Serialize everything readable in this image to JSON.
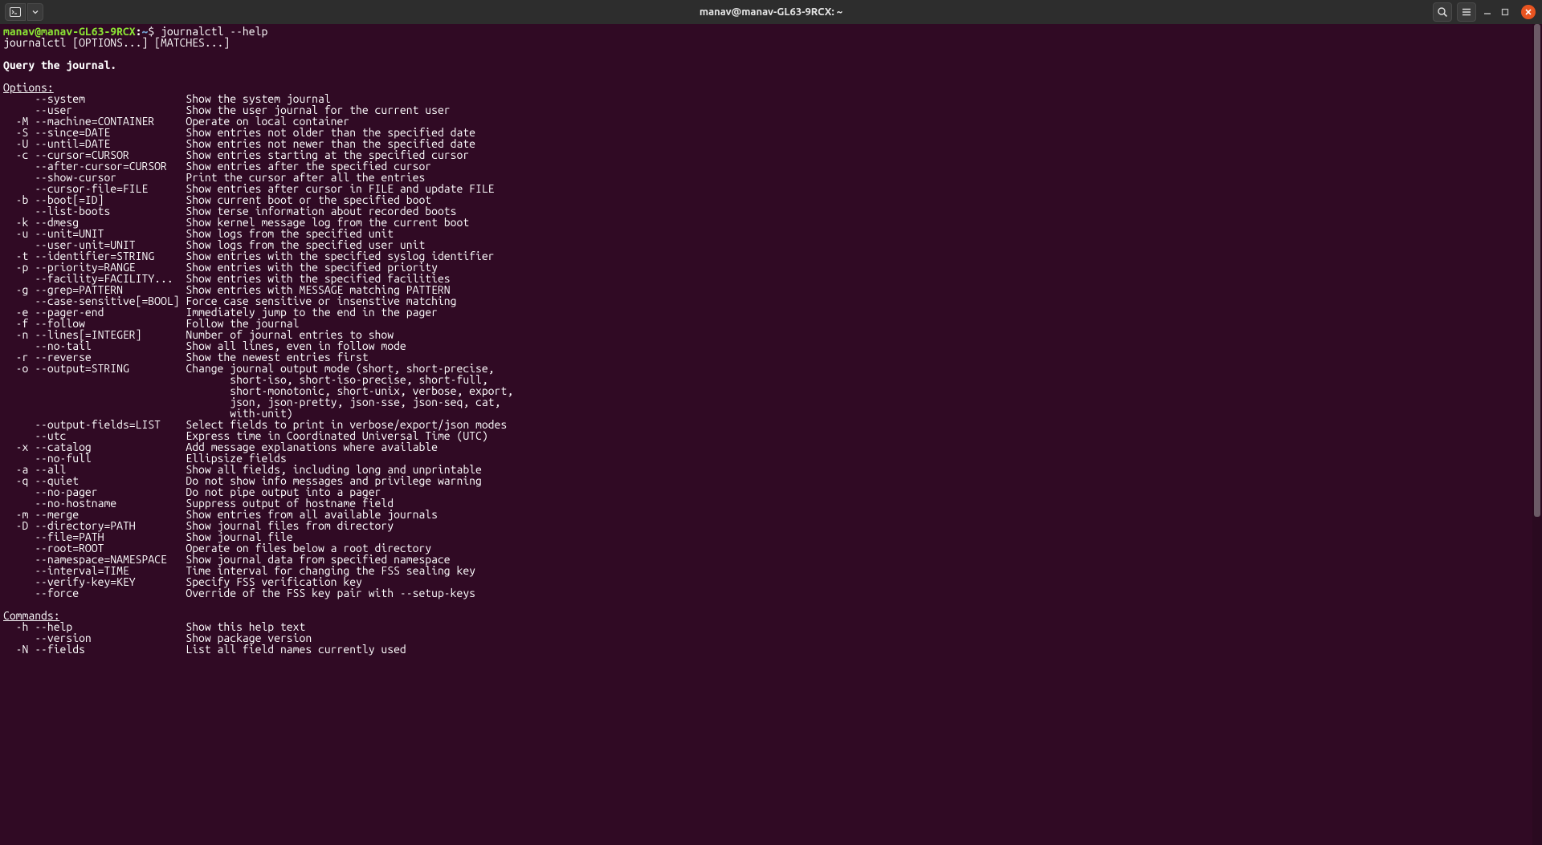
{
  "titlebar": {
    "title": "manav@manav-GL63-9RCX: ~"
  },
  "prompt": {
    "user_host": "manav@manav-GL63-9RCX",
    "colon": ":",
    "path": "~",
    "dollar": "$",
    "command": "journalctl --help"
  },
  "output": {
    "usage": "journalctl [OPTIONS...] [MATCHES...]",
    "description": "Query the journal.",
    "options_header": "Options:",
    "commands_header": "Commands:",
    "option_rows": [
      {
        "flag": "     --system",
        "desc": "Show the system journal"
      },
      {
        "flag": "     --user",
        "desc": "Show the user journal for the current user"
      },
      {
        "flag": "  -M --machine=CONTAINER",
        "desc": "Operate on local container"
      },
      {
        "flag": "  -S --since=DATE",
        "desc": "Show entries not older than the specified date"
      },
      {
        "flag": "  -U --until=DATE",
        "desc": "Show entries not newer than the specified date"
      },
      {
        "flag": "  -c --cursor=CURSOR",
        "desc": "Show entries starting at the specified cursor"
      },
      {
        "flag": "     --after-cursor=CURSOR",
        "desc": "Show entries after the specified cursor"
      },
      {
        "flag": "     --show-cursor",
        "desc": "Print the cursor after all the entries"
      },
      {
        "flag": "     --cursor-file=FILE",
        "desc": "Show entries after cursor in FILE and update FILE"
      },
      {
        "flag": "  -b --boot[=ID]",
        "desc": "Show current boot or the specified boot"
      },
      {
        "flag": "     --list-boots",
        "desc": "Show terse information about recorded boots"
      },
      {
        "flag": "  -k --dmesg",
        "desc": "Show kernel message log from the current boot"
      },
      {
        "flag": "  -u --unit=UNIT",
        "desc": "Show logs from the specified unit"
      },
      {
        "flag": "     --user-unit=UNIT",
        "desc": "Show logs from the specified user unit"
      },
      {
        "flag": "  -t --identifier=STRING",
        "desc": "Show entries with the specified syslog identifier"
      },
      {
        "flag": "  -p --priority=RANGE",
        "desc": "Show entries with the specified priority"
      },
      {
        "flag": "     --facility=FACILITY...",
        "desc": "Show entries with the specified facilities"
      },
      {
        "flag": "  -g --grep=PATTERN",
        "desc": "Show entries with MESSAGE matching PATTERN"
      },
      {
        "flag": "     --case-sensitive[=BOOL]",
        "desc": "Force case sensitive or insenstive matching"
      },
      {
        "flag": "  -e --pager-end",
        "desc": "Immediately jump to the end in the pager"
      },
      {
        "flag": "  -f --follow",
        "desc": "Follow the journal"
      },
      {
        "flag": "  -n --lines[=INTEGER]",
        "desc": "Number of journal entries to show"
      },
      {
        "flag": "     --no-tail",
        "desc": "Show all lines, even in follow mode"
      },
      {
        "flag": "  -r --reverse",
        "desc": "Show the newest entries first"
      },
      {
        "flag": "  -o --output=STRING",
        "desc": "Change journal output mode (short, short-precise,"
      },
      {
        "flag": "",
        "desc": "       short-iso, short-iso-precise, short-full,"
      },
      {
        "flag": "",
        "desc": "       short-monotonic, short-unix, verbose, export,"
      },
      {
        "flag": "",
        "desc": "       json, json-pretty, json-sse, json-seq, cat,"
      },
      {
        "flag": "",
        "desc": "       with-unit)"
      },
      {
        "flag": "     --output-fields=LIST",
        "desc": "Select fields to print in verbose/export/json modes"
      },
      {
        "flag": "     --utc",
        "desc": "Express time in Coordinated Universal Time (UTC)"
      },
      {
        "flag": "  -x --catalog",
        "desc": "Add message explanations where available"
      },
      {
        "flag": "     --no-full",
        "desc": "Ellipsize fields"
      },
      {
        "flag": "  -a --all",
        "desc": "Show all fields, including long and unprintable"
      },
      {
        "flag": "  -q --quiet",
        "desc": "Do not show info messages and privilege warning"
      },
      {
        "flag": "     --no-pager",
        "desc": "Do not pipe output into a pager"
      },
      {
        "flag": "     --no-hostname",
        "desc": "Suppress output of hostname field"
      },
      {
        "flag": "  -m --merge",
        "desc": "Show entries from all available journals"
      },
      {
        "flag": "  -D --directory=PATH",
        "desc": "Show journal files from directory"
      },
      {
        "flag": "     --file=PATH",
        "desc": "Show journal file"
      },
      {
        "flag": "     --root=ROOT",
        "desc": "Operate on files below a root directory"
      },
      {
        "flag": "     --namespace=NAMESPACE",
        "desc": "Show journal data from specified namespace"
      },
      {
        "flag": "     --interval=TIME",
        "desc": "Time interval for changing the FSS sealing key"
      },
      {
        "flag": "     --verify-key=KEY",
        "desc": "Specify FSS verification key"
      },
      {
        "flag": "     --force",
        "desc": "Override of the FSS key pair with --setup-keys"
      }
    ],
    "command_rows": [
      {
        "flag": "  -h --help",
        "desc": "Show this help text"
      },
      {
        "flag": "     --version",
        "desc": "Show package version"
      },
      {
        "flag": "  -N --fields",
        "desc": "List all field names currently used"
      }
    ]
  },
  "layout": {
    "desc_col": 29
  }
}
